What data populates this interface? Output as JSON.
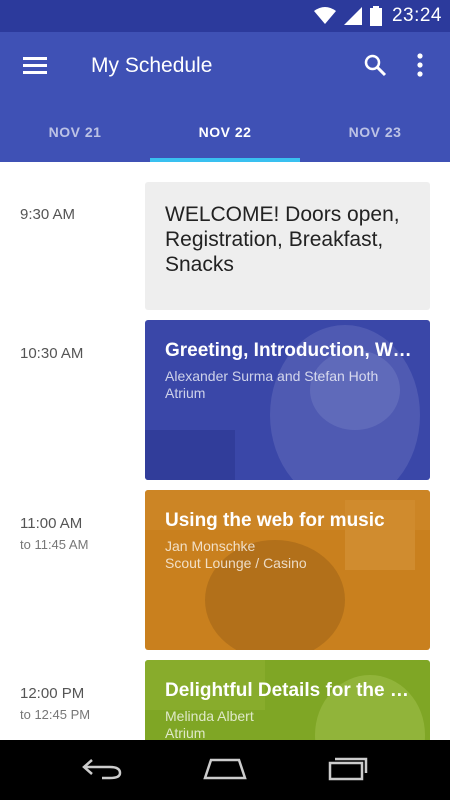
{
  "status_bar": {
    "time": "23:24",
    "icons": [
      "wifi-icon",
      "cell-signal-icon",
      "battery-icon"
    ]
  },
  "app_bar": {
    "title": "My Schedule",
    "icons": [
      "menu-icon",
      "search-icon",
      "more-vert-icon"
    ]
  },
  "tabs": [
    {
      "label": "NOV 21",
      "active": false
    },
    {
      "label": "NOV 22",
      "active": true
    },
    {
      "label": "NOV 23",
      "active": false
    }
  ],
  "colors": {
    "primary": "#3f51b5",
    "status_bar": "#2c3a9c",
    "tab_indicator": "#39c0f0",
    "card_blue": "#3a47a8",
    "card_orange": "#c9801e",
    "card_green": "#7fa625",
    "card_plain": "#eeeeee"
  },
  "schedule": [
    {
      "start": "9:30 AM",
      "end": "",
      "title": "WELCOME! Doors open, Registration, Breakfast, Snacks",
      "speaker": "",
      "room": ""
    },
    {
      "start": "10:30 AM",
      "end": "",
      "title": "Greeting, Introduction, Welcome",
      "speaker": "Alexander Surma and Stefan Hoth",
      "room": "Atrium"
    },
    {
      "start": "11:00 AM",
      "end": "to 11:45 AM",
      "title": "Using the web for music",
      "speaker": "Jan Monschke",
      "room": "Scout Lounge / Casino"
    },
    {
      "start": "12:00 PM",
      "end": "to 12:45 PM",
      "title": "Delightful Details for the web",
      "speaker": "Melinda Albert",
      "room": "Atrium"
    }
  ],
  "nav_bar": {
    "icons": [
      "back-icon",
      "home-icon",
      "recents-icon"
    ]
  }
}
